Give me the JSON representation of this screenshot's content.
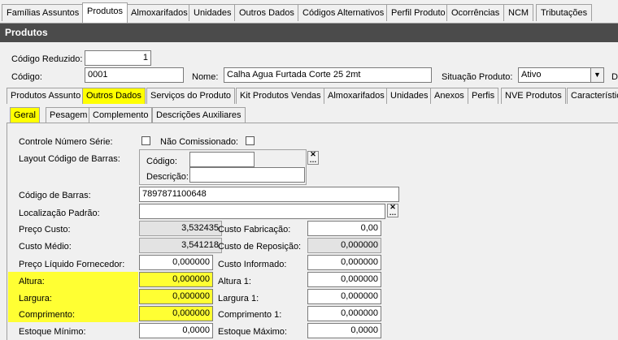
{
  "top_tabs": [
    "Famílias Assuntos",
    "Produtos",
    "Almoxarifados",
    "Unidades",
    "Outros Dados",
    "Códigos Alternativos",
    "Perfil Produto",
    "Ocorrências",
    "NCM",
    "Tributações"
  ],
  "title": "Produtos",
  "header": {
    "codigo_reduzido_label": "Código Reduzido:",
    "codigo_reduzido_value": "1",
    "codigo_label": "Código:",
    "codigo_value": "0001",
    "nome_label": "Nome:",
    "nome_value": "Calha Agua Furtada Corte 25  2mt",
    "situacao_label": "Situação Produto:",
    "situacao_value": "Ativo",
    "trailing_letter": "D"
  },
  "sub_tabs": [
    "Produtos Assunto",
    "Outros Dados",
    "Serviços do Produto",
    "Kit Produtos Vendas",
    "Almoxarifados",
    "Unidades",
    "Anexos",
    "Perfis",
    "NVE Produtos",
    "Característic"
  ],
  "group_tabs": [
    "Geral",
    "Pesagem",
    "Complemento",
    "Descrições Auxiliares"
  ],
  "form": {
    "controle_numero_serie": "Controle Número Série:",
    "nao_comissionado": "Não Comissionado:",
    "layout_codigo_barras": "Layout Código de Barras:",
    "layout_codigo": "Código:",
    "layout_descricao": "Descrição:",
    "codigo_barras_label": "Código de Barras:",
    "codigo_barras_value": "7897871100648",
    "localizacao_label": "Localização Padrão:",
    "preco_custo_label": "Preço Custo:",
    "preco_custo_value": "3,532435",
    "custo_fabricacao_label": "Custo Fabricação:",
    "custo_fabricacao_value": "0,00",
    "custo_medio_label": "Custo Médio:",
    "custo_medio_value": "3,541218",
    "custo_reposicao_label": "Custo de Reposição:",
    "custo_reposicao_value": "0,000000",
    "preco_liquido_label": "Preço Líquido Fornecedor:",
    "preco_liquido_value": "0,000000",
    "custo_informado_label": "Custo Informado:",
    "custo_informado_value": "0,000000",
    "altura_label": "Altura:",
    "altura_value": "0,000000",
    "altura1_label": "Altura 1:",
    "altura1_value": "0,000000",
    "largura_label": "Largura:",
    "largura_value": "0,000000",
    "largura1_label": "Largura 1:",
    "largura1_value": "0,000000",
    "comprimento_label": "Comprimento:",
    "comprimento_value": "0,000000",
    "comprimento1_label": "Comprimento 1:",
    "comprimento1_value": "0,000000",
    "estoque_minimo_label": "Estoque Mínimo:",
    "estoque_minimo_value": "0,0000",
    "estoque_maximo_label": "Estoque Máximo:",
    "estoque_maximo_value": "0,0000"
  },
  "icons": {
    "clear": "close-icon",
    "dropdown": "chevron-down-icon"
  },
  "colors": {
    "title_bar": "#4b4b4b",
    "highlight": "#ffff00"
  }
}
